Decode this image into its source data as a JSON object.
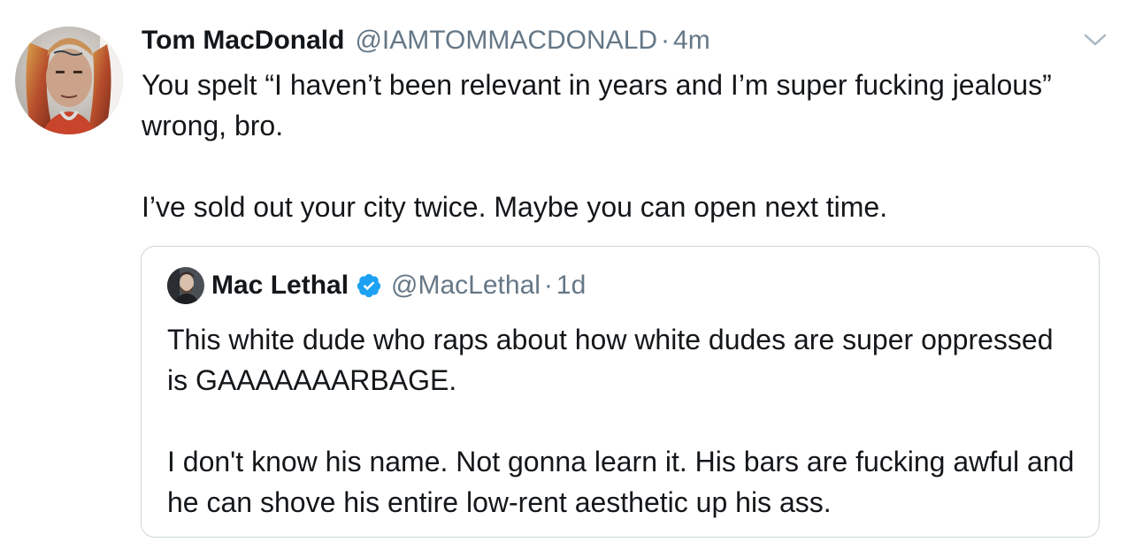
{
  "tweet": {
    "author_name": "Tom MacDonald",
    "author_handle": "@IAMTOMMACDONALD",
    "separator": "·",
    "time": "4m",
    "avatar_icon": "profile-photo",
    "menu_icon": "chevron-down-icon",
    "paragraphs": [
      "You spelt “I haven’t been relevant in years and I’m super fucking jealous” wrong, bro.",
      "I’ve sold out your city twice. Maybe you can open next time."
    ]
  },
  "quoted_tweet": {
    "author_name": "Mac Lethal",
    "verified_icon": "verified-badge-icon",
    "author_handle": "@MacLethal",
    "separator": "·",
    "time": "1d",
    "paragraphs": [
      "This white dude who raps about how white dudes are super oppressed is GAAAAAAARBAGE.",
      "I don't know his name. Not gonna learn it. His bars are fucking awful and he can shove his entire low-rent aesthetic up his ass."
    ]
  },
  "colors": {
    "text": "#14171a",
    "secondary": "#657786",
    "border": "#ccd6dd",
    "verified": "#1da1f2"
  }
}
